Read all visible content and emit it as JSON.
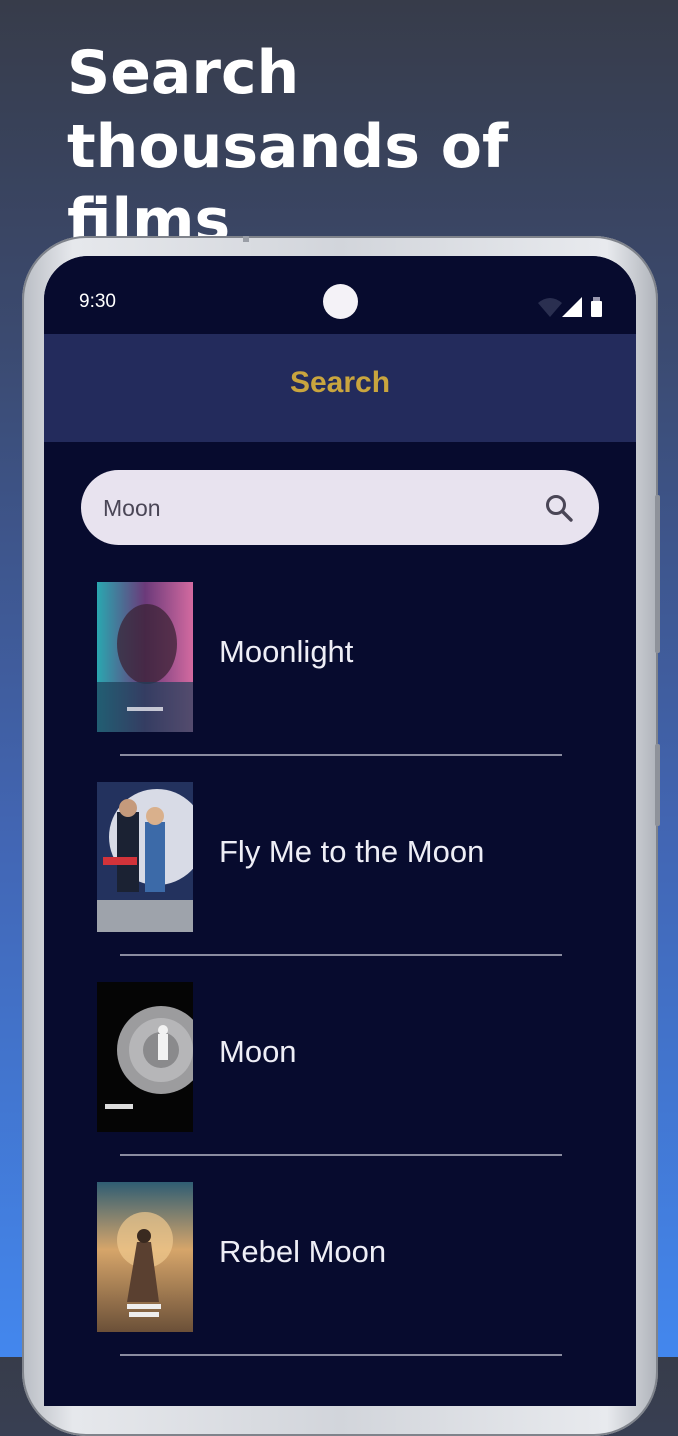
{
  "headline": "Search thousands of films",
  "status_bar": {
    "time": "9:30"
  },
  "app_bar": {
    "title": "Search"
  },
  "search": {
    "value": "Moon"
  },
  "results": [
    {
      "title": "Moonlight"
    },
    {
      "title": "Fly Me to the Moon"
    },
    {
      "title": "Moon"
    },
    {
      "title": "Rebel Moon"
    }
  ],
  "colors": {
    "background_top": "#373c4a",
    "background_bottom": "#4387ee",
    "screen_background": "#070b2e",
    "app_bar": "#232b5c",
    "app_title": "#c9a53e",
    "search_field": "#e8e3ef",
    "result_text": "#eeeef6"
  }
}
